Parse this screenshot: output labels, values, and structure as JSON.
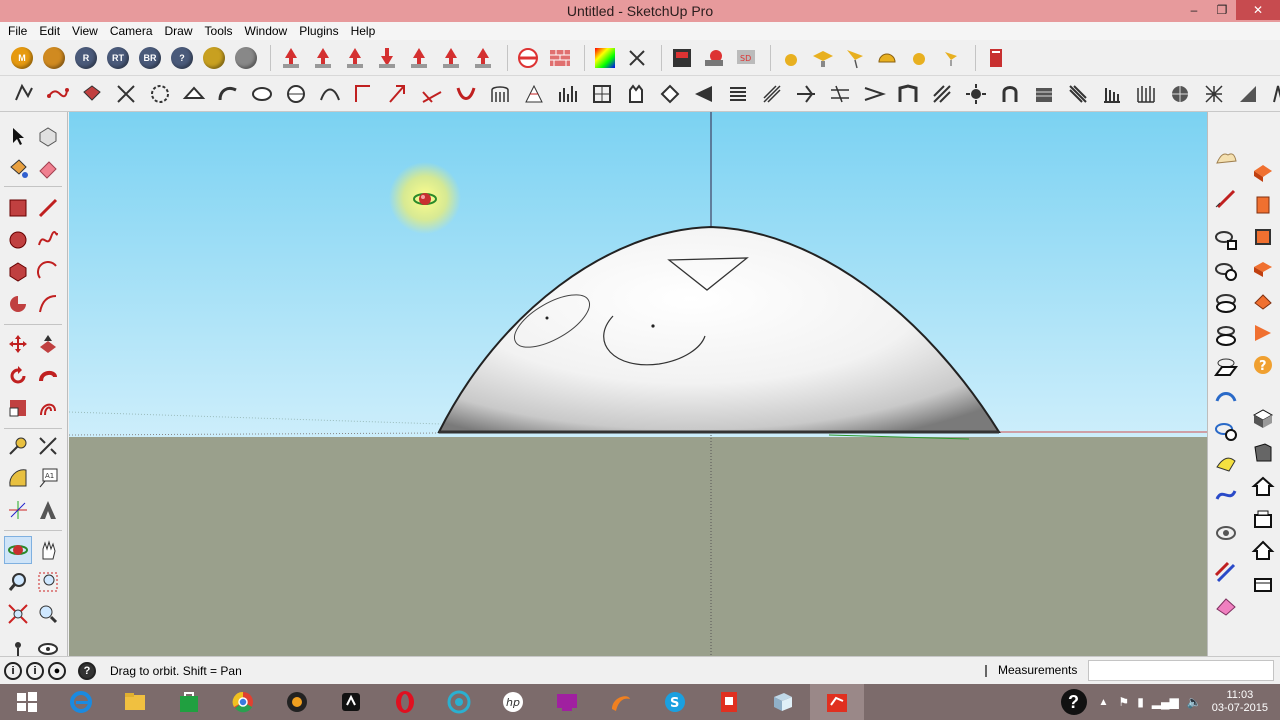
{
  "window": {
    "title": "Untitled - SketchUp Pro",
    "minimize": "‒",
    "restore": "❐",
    "close": "✕"
  },
  "menu": [
    "File",
    "Edit",
    "View",
    "Camera",
    "Draw",
    "Tools",
    "Window",
    "Plugins",
    "Help"
  ],
  "toolbar1": {
    "balls": [
      {
        "label": "M",
        "color": "#e69a10"
      },
      {
        "label": "",
        "color": "#d08a20"
      },
      {
        "label": "R",
        "color": "#4a5a7a"
      },
      {
        "label": "RT",
        "color": "#4a5a7a"
      },
      {
        "label": "BR",
        "color": "#4a5a7a"
      },
      {
        "label": "?",
        "color": "#4a5a7a"
      },
      {
        "label": "",
        "color": "#c8a020"
      },
      {
        "label": "",
        "color": "#888888"
      }
    ]
  },
  "status": {
    "hint": "Drag to orbit.  Shift = Pan",
    "measurements_label": "Measurements",
    "measurements_value": ""
  },
  "taskbar": {
    "clock_time": "11:03",
    "clock_date": "03-07-2015",
    "help_glyph": "?"
  },
  "colors": {
    "accent_orbit": "#d63a3a",
    "sky_top": "#7bd2f2",
    "ground": "#9aa08c",
    "titlebar": "#e79a9c"
  }
}
